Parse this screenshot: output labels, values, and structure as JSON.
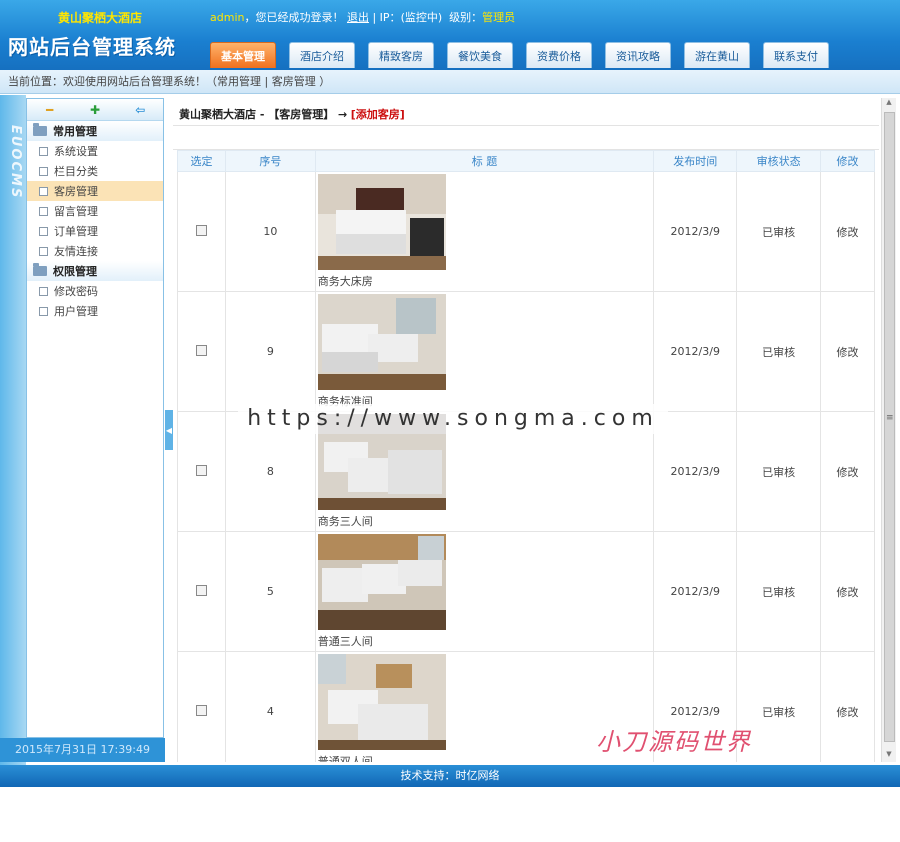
{
  "header": {
    "hotel_name": "黄山聚栖大酒店",
    "user": "admin",
    "login_msg": "，您已经成功登录！",
    "logout": "退出",
    "ip_label": "| IP：",
    "ip_value": "(监控中)",
    "level_label": "级别：",
    "level_value": "管理员",
    "logo_text": "网站后台管理系统"
  },
  "nav": [
    "基本管理",
    "酒店介绍",
    "精致客房",
    "餐饮美食",
    "资费价格",
    "资讯攻略",
    "游在黄山",
    "联系支付"
  ],
  "breadcrumb": "当前位置：欢迎使用网站后台管理系统！（常用管理 | 客房管理 ）",
  "sidebar": {
    "vertical_brand": "EUOCMS",
    "groups": [
      {
        "title": "常用管理",
        "items": [
          "系统设置",
          "栏目分类",
          "客房管理",
          "留言管理",
          "订单管理",
          "友情连接"
        ]
      },
      {
        "title": "权限管理",
        "items": [
          "修改密码",
          "用户管理"
        ]
      }
    ],
    "date": "2015年7月31日 17:39:49"
  },
  "main": {
    "head_prefix": "黄山聚栖大酒店 - 【客房管理】 →",
    "add_link": "[添加客房]",
    "columns": [
      "选定",
      "序号",
      "标 题",
      "发布时间",
      "审核状态",
      "修改"
    ],
    "rows": [
      {
        "id": "10",
        "title": "商务大床房",
        "date": "2012/3/9",
        "status": "已审核",
        "edit": "修改"
      },
      {
        "id": "9",
        "title": "商务标准间",
        "date": "2012/3/9",
        "status": "已审核",
        "edit": "修改"
      },
      {
        "id": "8",
        "title": "商务三人间",
        "date": "2012/3/9",
        "status": "已审核",
        "edit": "修改"
      },
      {
        "id": "5",
        "title": "普通三人间",
        "date": "2012/3/9",
        "status": "已审核",
        "edit": "修改"
      },
      {
        "id": "4",
        "title": "普通双人间",
        "date": "2012/3/9",
        "status": "已审核",
        "edit": "修改"
      }
    ]
  },
  "footer": "技术支持：时亿网络",
  "overlay": {
    "watermark": "https://www.songma.com",
    "signature": "小刀源码世界"
  }
}
